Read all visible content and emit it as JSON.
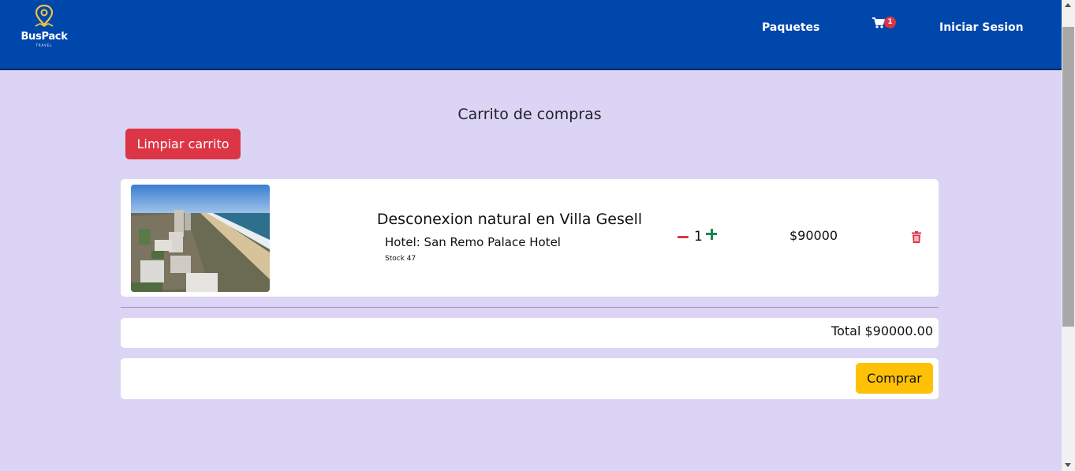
{
  "navbar": {
    "logo_text": "BusPack",
    "logo_subtext": "TRAVEL",
    "links": {
      "paquetes": "Paquetes",
      "login": "Iniciar Sesion"
    },
    "cart_count": "1",
    "bg_color": "#0047ab"
  },
  "page": {
    "title": "Carrito de compras",
    "clear_button": "Limpiar carrito"
  },
  "cart_items": [
    {
      "image": "beach-city-aerial-photo",
      "title": "Desconexion natural en Villa Gesell",
      "hotel": "Hotel: San Remo Palace Hotel",
      "stock": "Stock 47",
      "quantity": "1",
      "price": "$90000"
    }
  ],
  "summary": {
    "total": "Total $90000.00",
    "buy_button": "Comprar"
  },
  "colors": {
    "background": "#dcd4f5",
    "danger": "#dc3545",
    "success": "#198754",
    "warning": "#ffc107"
  }
}
